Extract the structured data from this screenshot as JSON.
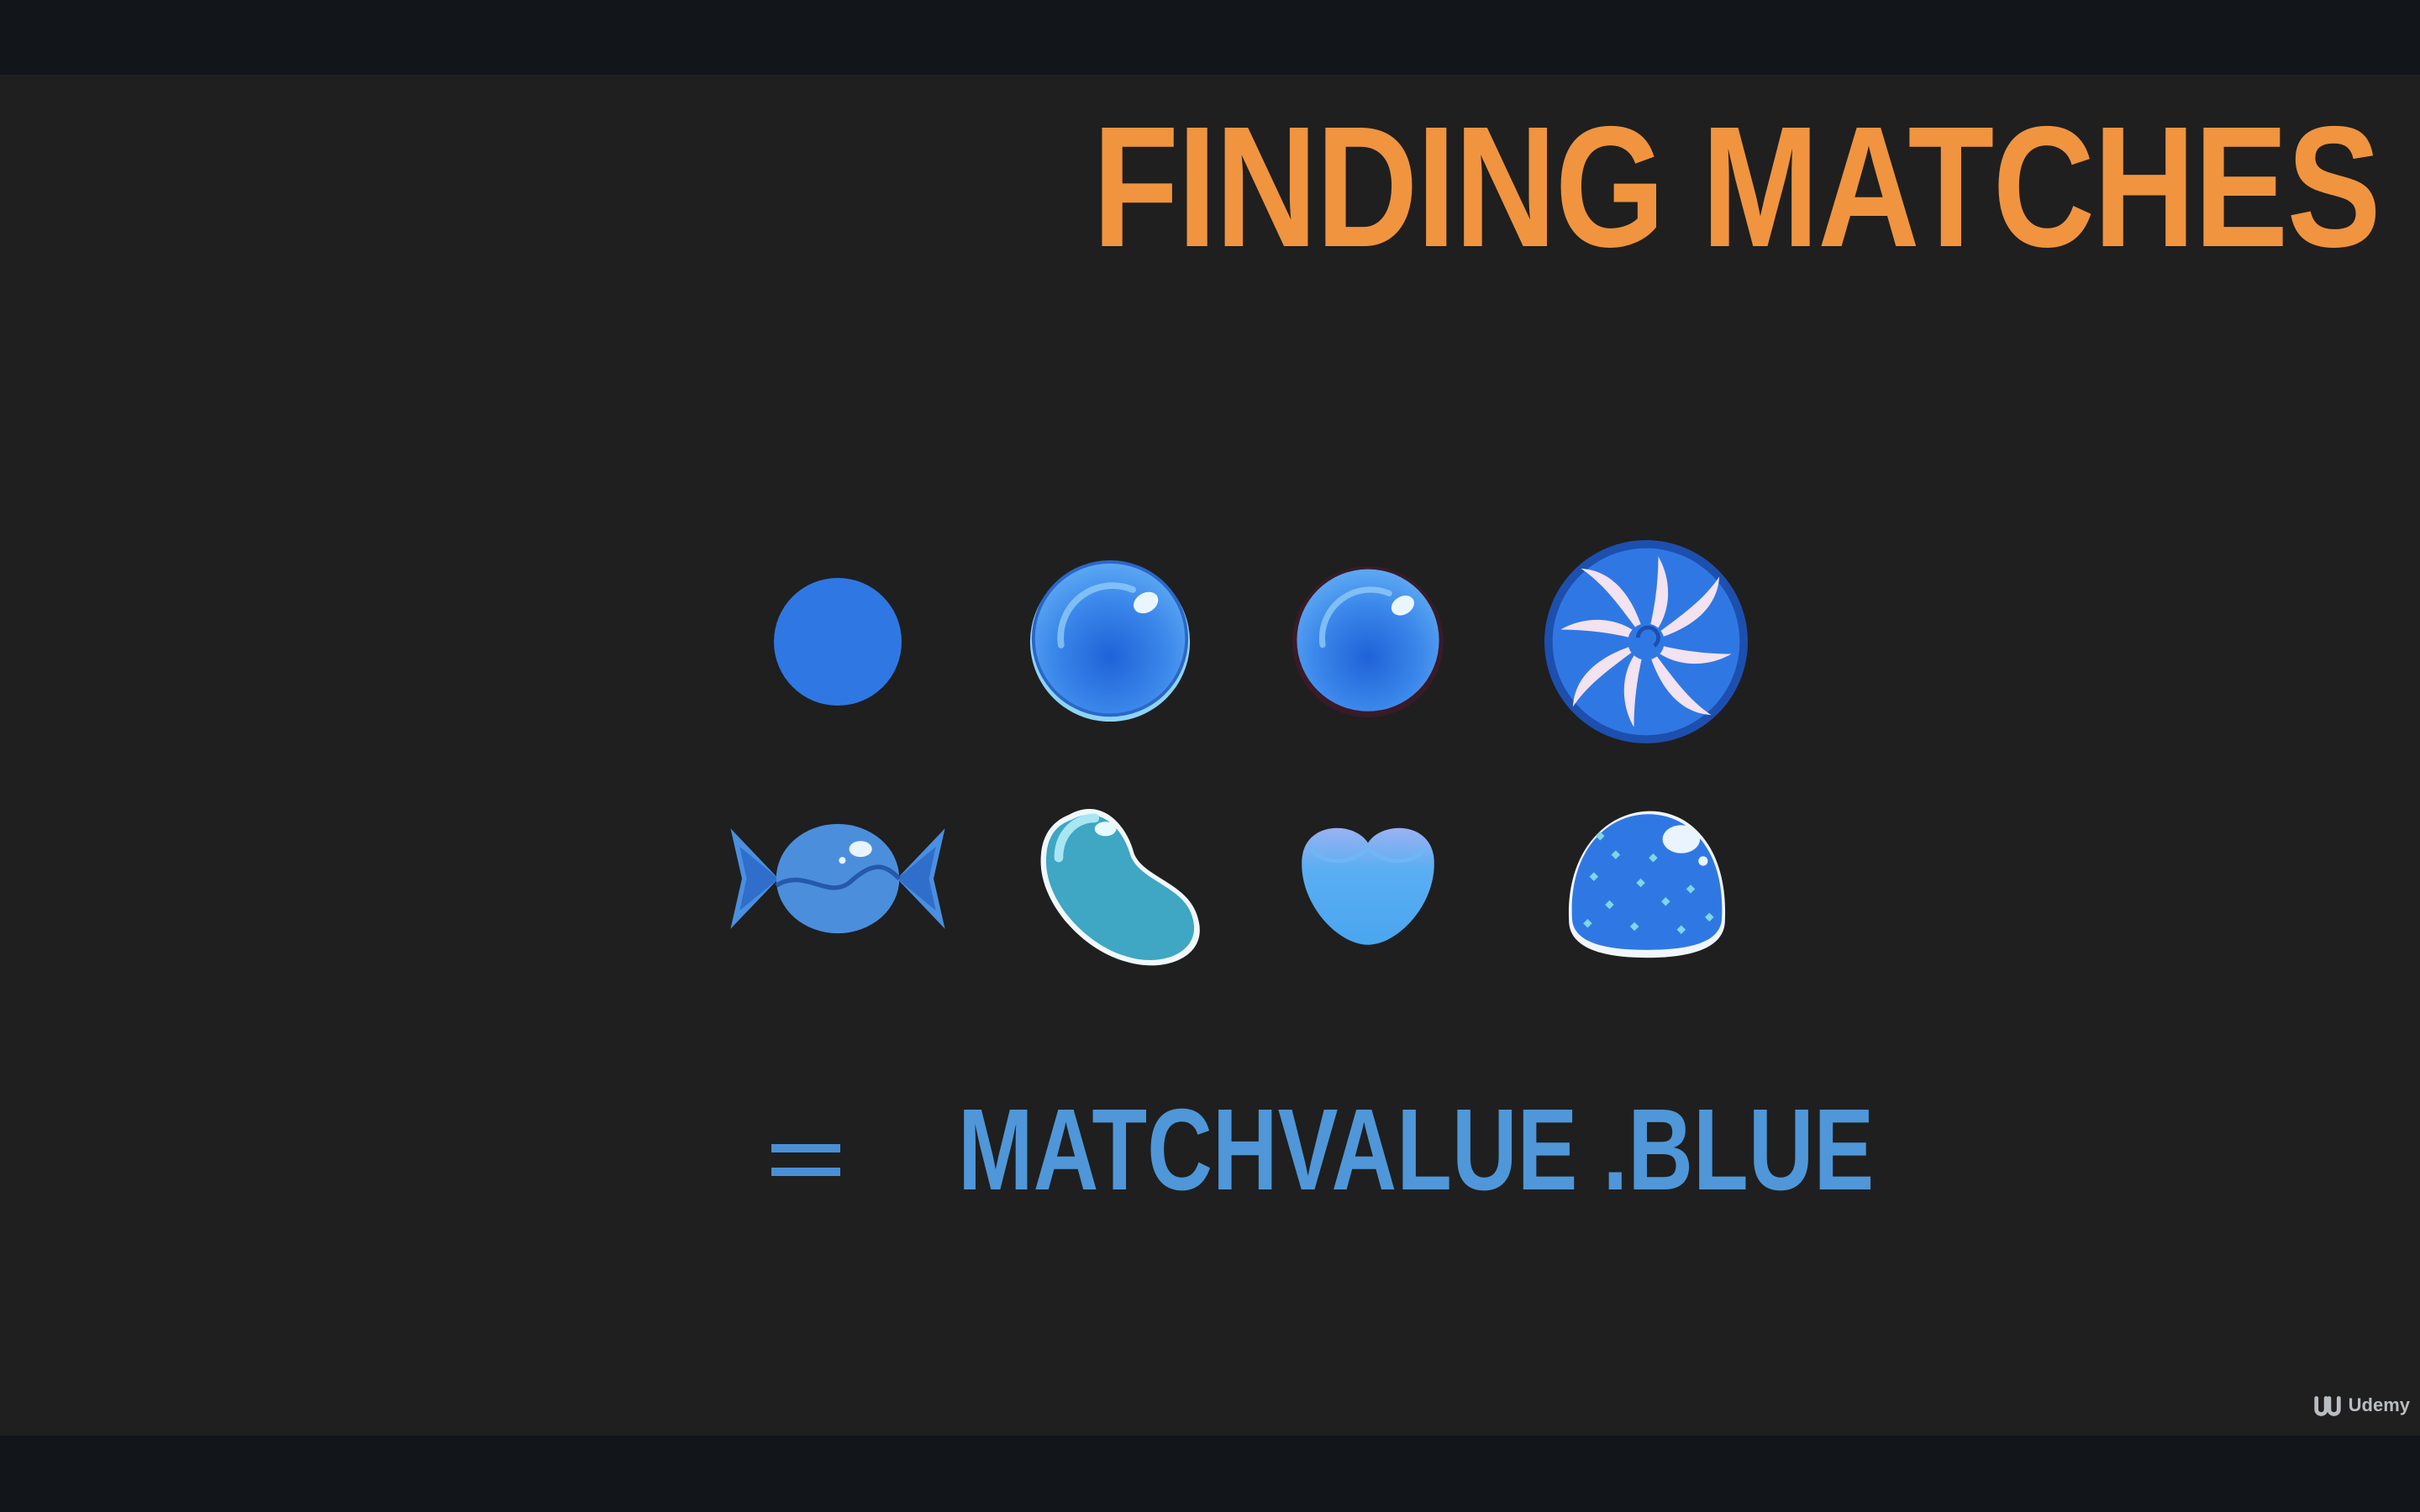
{
  "slide": {
    "title": "FINDING MATCHES",
    "equals_symbol": "=",
    "match_value": "MATCHVALUE .BLUE",
    "title_color": "#f0943f",
    "value_color": "#4f97d8"
  },
  "candies": [
    {
      "name": "plain-blue-dot-icon",
      "variant": "plain"
    },
    {
      "name": "glossy-blue-sphere-icon",
      "variant": "glossy"
    },
    {
      "name": "glossy-blue-sphere-outlined-icon",
      "variant": "glossy-outlined"
    },
    {
      "name": "blue-swirl-lollipop-icon",
      "variant": "swirl"
    },
    {
      "name": "wrapped-blue-candy-icon",
      "variant": "wrapped"
    },
    {
      "name": "blue-jellybean-icon",
      "variant": "jellybean"
    },
    {
      "name": "blue-heart-candy-icon",
      "variant": "heart"
    },
    {
      "name": "blue-gumdrop-icon",
      "variant": "gumdrop"
    }
  ],
  "watermark": {
    "brand": "Udemy",
    "icon": "udemy-logo-icon"
  }
}
